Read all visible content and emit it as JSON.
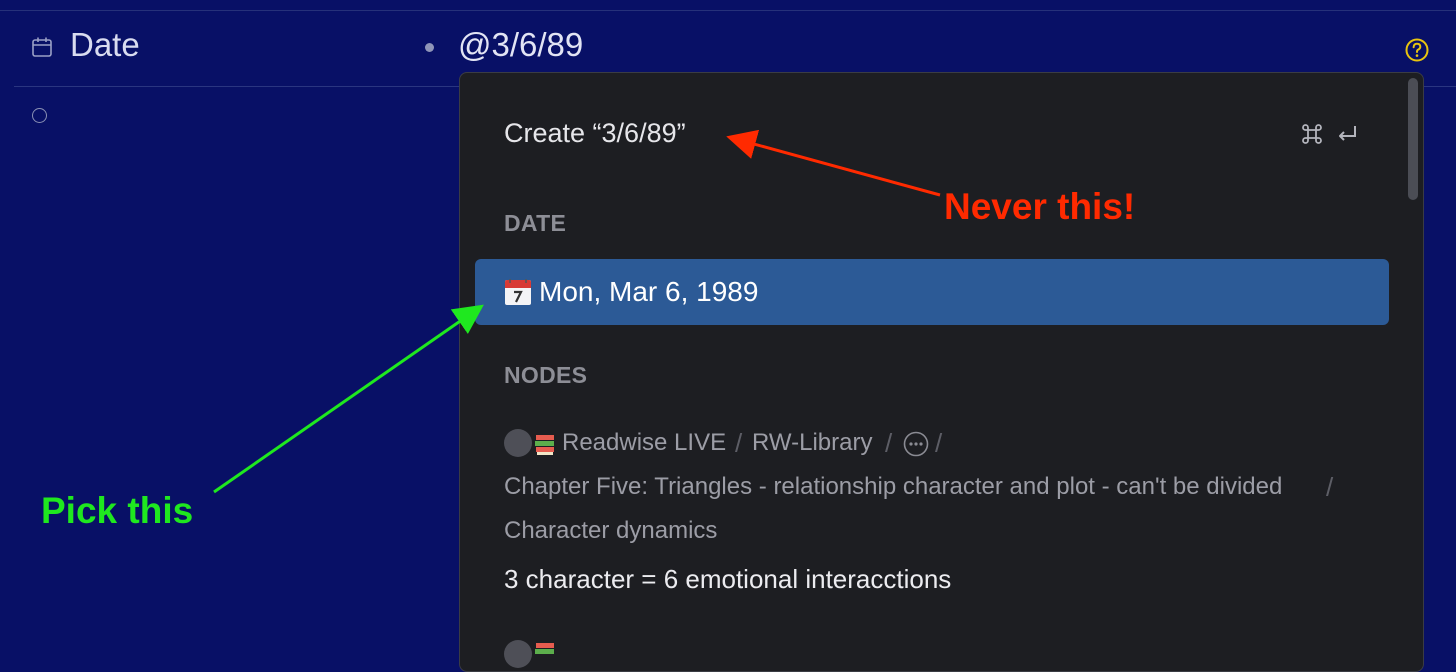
{
  "field": {
    "label": "Date",
    "value": "@3/6/89",
    "icon": "calendar-outline-icon",
    "help_icon": "question-circle-icon",
    "help_color": "#e8c40f"
  },
  "dropdown": {
    "create_text": "Create “3/6/89”",
    "shortcut_icons": [
      "command-key-icon",
      "enter-key-icon"
    ],
    "date_section": "DATE",
    "date_option": "Mon, Mar 6, 1989",
    "date_option_icon": "calendar-emoji-icon",
    "nodes_section": "NODES",
    "node": {
      "path": [
        "Readwise LIVE",
        "RW-Library",
        "Chapter Five: Triangles - relationship character and plot - can't be divided",
        "Character dynamics"
      ],
      "path_icons": [
        "avatar",
        "books-emoji-icon",
        "ellipsis-circle-icon"
      ],
      "title": "3 character = 6 emotional interacctions"
    }
  },
  "annotations": {
    "never": "Never this!",
    "pick": "Pick this",
    "never_color": "#ff2a00",
    "pick_color": "#1fe81f"
  },
  "colors": {
    "background": "#081066",
    "dropdown_bg": "#1d1e22",
    "selected_bg": "#2c5a96"
  }
}
